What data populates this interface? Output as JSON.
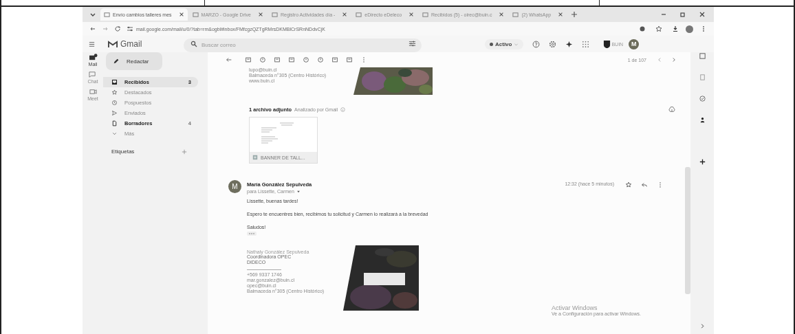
{
  "browser": {
    "tabs": [
      {
        "title": "Envío cambios talleres mes",
        "selected": true
      },
      {
        "title": "MARZO - Google Drive",
        "selected": false
      },
      {
        "title": "Registro Actividades día -",
        "selected": false
      },
      {
        "title": "eDirecto eDeleco",
        "selected": false
      },
      {
        "title": "Recibidos (5) - oirec@buin.c",
        "selected": false
      },
      {
        "title": "(2) WhatsApp",
        "selected": false
      }
    ],
    "url": "mail.google.com/mail/u/0/?tab=rm&ogbl#inbox/FMfcgzQZTgRMrsDKMBlCrSRnNDdvCjK"
  },
  "header": {
    "product": "Gmail",
    "search_placeholder": "Buscar correo",
    "status": "Activo",
    "org": "BUIN",
    "avatar": "M"
  },
  "rail": [
    {
      "label": "Mail",
      "selected": true
    },
    {
      "label": "Chat",
      "selected": false
    },
    {
      "label": "Meet",
      "selected": false
    }
  ],
  "compose": "Redactar",
  "nav": [
    {
      "label": "Recibidos",
      "count": "3",
      "unread": true,
      "selected": true
    },
    {
      "label": "Destacados",
      "unread": false,
      "selected": false
    },
    {
      "label": "Pospuestos",
      "unread": false,
      "selected": false
    },
    {
      "label": "Enviados",
      "unread": false,
      "selected": false
    },
    {
      "label": "Borradores",
      "count": "4",
      "unread": true,
      "selected": false
    },
    {
      "label": "Más",
      "unread": false,
      "selected": false
    }
  ],
  "labels_heading": "Etiquetas",
  "pager": "1 de 107",
  "previous_signature": [
    "lupo@buin.cl",
    "Balmaceda n°305 (Centro Histórico)",
    "www.buin.cl"
  ],
  "attachments": {
    "count": "1 archivo adjunto",
    "scan": "Analizado por Gmail",
    "file": "BANNER DE TALL..."
  },
  "message": {
    "avatar": "M",
    "sender": "María González Sepulveda",
    "recipients": "para Lissette, Carmen",
    "time": "12:32 (hace 5 minutos)",
    "body": [
      "Lissette, buenas tardes!",
      "Espero te encuentres bien, recibimos tu solicitud y Carmen lo realizará a la brevedad",
      "Saludos!"
    ],
    "signature": {
      "name": "Nathaly González Sepulveda",
      "role": [
        "Coordinadora OPEC",
        "DIDECO"
      ],
      "contact": [
        "+569 9337 1746",
        "mar.gonzalez@buin.cl",
        "opec@buin.cl",
        "Balmaceda n°305 (Centro Histórico)"
      ]
    }
  },
  "windows_notice": {
    "title": "Activar Windows",
    "text": "Ve a Configuración para activar Windows."
  }
}
